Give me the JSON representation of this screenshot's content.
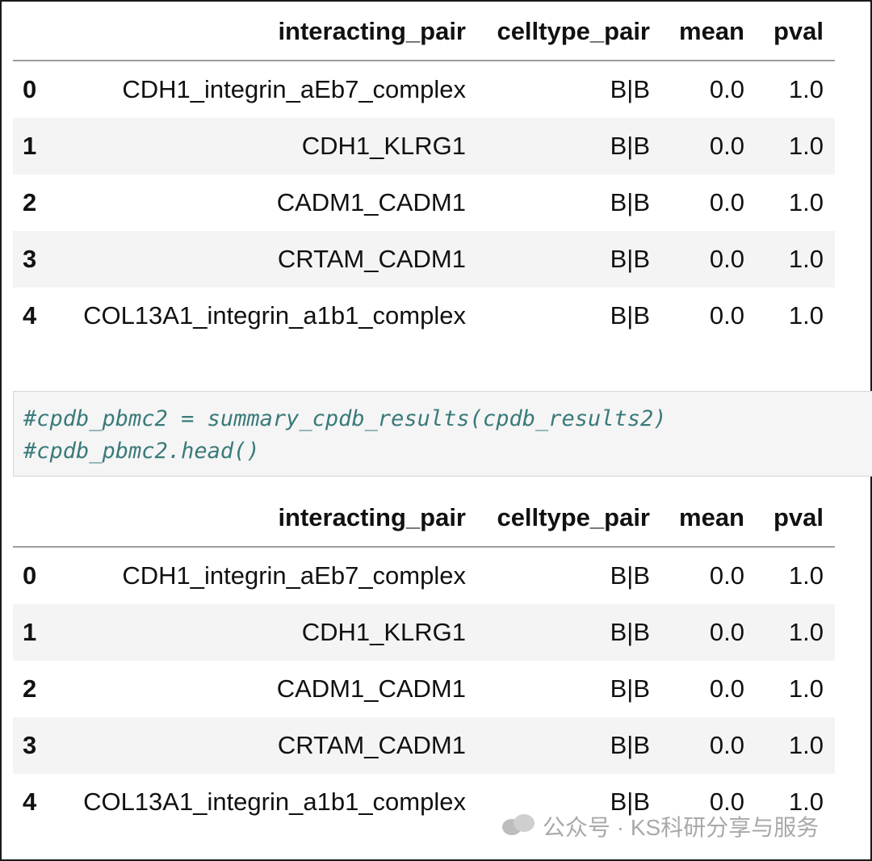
{
  "table1": {
    "columns": [
      "interacting_pair",
      "celltype_pair",
      "mean",
      "pval"
    ],
    "rows": [
      {
        "index": "0",
        "interacting_pair": "CDH1_integrin_aEb7_complex",
        "celltype_pair": "B|B",
        "mean": "0.0",
        "pval": "1.0"
      },
      {
        "index": "1",
        "interacting_pair": "CDH1_KLRG1",
        "celltype_pair": "B|B",
        "mean": "0.0",
        "pval": "1.0"
      },
      {
        "index": "2",
        "interacting_pair": "CADM1_CADM1",
        "celltype_pair": "B|B",
        "mean": "0.0",
        "pval": "1.0"
      },
      {
        "index": "3",
        "interacting_pair": "CRTAM_CADM1",
        "celltype_pair": "B|B",
        "mean": "0.0",
        "pval": "1.0"
      },
      {
        "index": "4",
        "interacting_pair": "COL13A1_integrin_a1b1_complex",
        "celltype_pair": "B|B",
        "mean": "0.0",
        "pval": "1.0"
      }
    ]
  },
  "code_cell": {
    "lines": [
      "#cpdb_pbmc2 = summary_cpdb_results(cpdb_results2)",
      "#cpdb_pbmc2.head()"
    ]
  },
  "table2": {
    "columns": [
      "interacting_pair",
      "celltype_pair",
      "mean",
      "pval"
    ],
    "rows": [
      {
        "index": "0",
        "interacting_pair": "CDH1_integrin_aEb7_complex",
        "celltype_pair": "B|B",
        "mean": "0.0",
        "pval": "1.0"
      },
      {
        "index": "1",
        "interacting_pair": "CDH1_KLRG1",
        "celltype_pair": "B|B",
        "mean": "0.0",
        "pval": "1.0"
      },
      {
        "index": "2",
        "interacting_pair": "CADM1_CADM1",
        "celltype_pair": "B|B",
        "mean": "0.0",
        "pval": "1.0"
      },
      {
        "index": "3",
        "interacting_pair": "CRTAM_CADM1",
        "celltype_pair": "B|B",
        "mean": "0.0",
        "pval": "1.0"
      },
      {
        "index": "4",
        "interacting_pair": "COL13A1_integrin_a1b1_complex",
        "celltype_pair": "B|B",
        "mean": "0.0",
        "pval": "1.0"
      }
    ]
  },
  "watermark": {
    "icon": "wechat-icon",
    "text": "公众号 · KS科研分享与服务"
  }
}
